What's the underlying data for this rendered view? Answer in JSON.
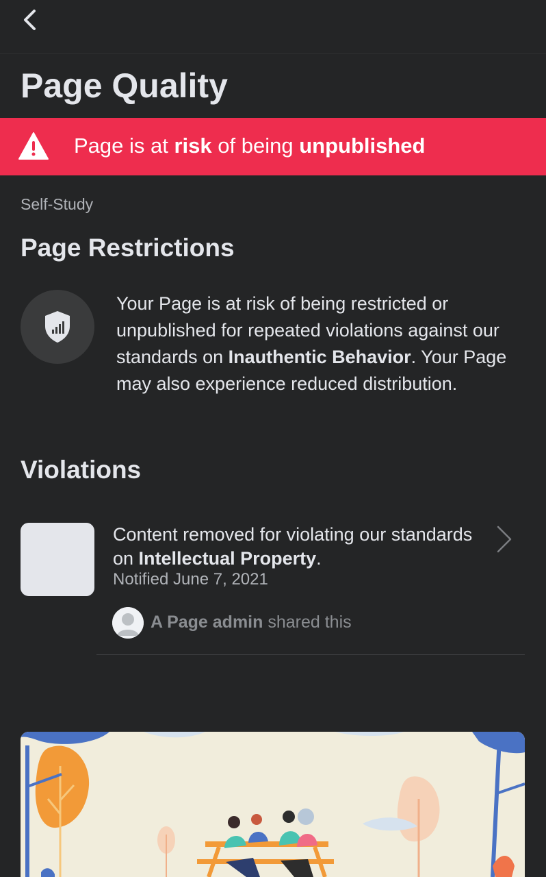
{
  "header": {
    "back_icon": "chevron-left-icon",
    "title": "Page Quality"
  },
  "alert": {
    "icon": "warning-icon",
    "color": "#ee2d4e",
    "text_1": "Page is at ",
    "text_bold_1": "risk",
    "text_2": " of being ",
    "text_bold_2": "unpublished"
  },
  "restrictions": {
    "kicker": "Self-Study",
    "heading": "Page Restrictions",
    "icon": "shield-stats-icon",
    "text_1": "Your Page is at risk of being restricted or unpublished for repeated violations against our standards on ",
    "text_bold": "Inauthentic Behavior",
    "text_2": ". Your Page may also experience reduced distribution."
  },
  "violations": {
    "heading": "Violations",
    "items": [
      {
        "text_1": "Content removed for violating our standards on ",
        "text_bold": "Intellectual Property",
        "text_2": ".",
        "notified": "Notified June 7, 2021",
        "admin_bold": "A Page admin",
        "admin_rest": " shared this",
        "chevron_icon": "chevron-right-icon"
      }
    ]
  },
  "colors": {
    "background": "#242526",
    "alert": "#ee2d4e",
    "illustration_bg": "#f1eddc"
  }
}
